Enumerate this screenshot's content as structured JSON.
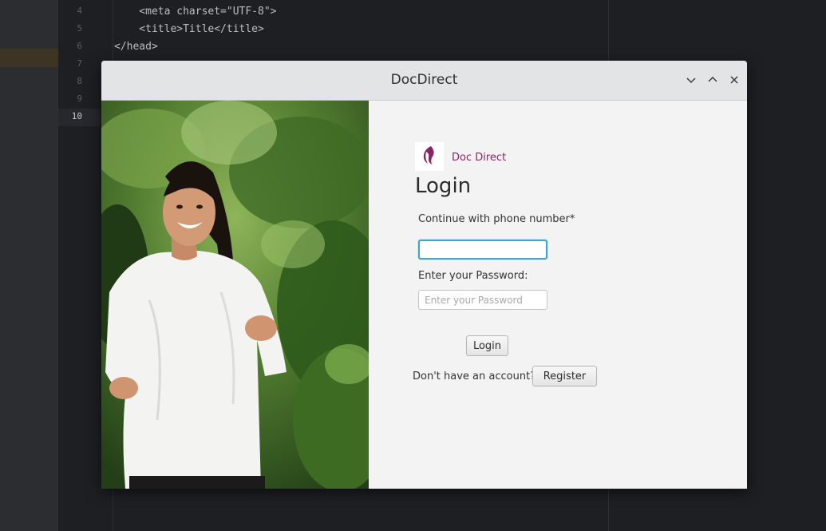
{
  "editor": {
    "line_numbers": [
      "4",
      "5",
      "6",
      "7",
      "8",
      "9",
      "10"
    ],
    "code_lines": [
      "    <meta charset=\"UTF-8\">",
      "    <title>Title</title>",
      "</head>"
    ]
  },
  "window": {
    "title": "DocDirect",
    "controls": {
      "minimize_icon": "chevron-down-icon",
      "maximize_icon": "chevron-up-icon",
      "close_icon": "close-icon"
    }
  },
  "brand": {
    "name": "Doc Direct",
    "color": "#8b2467"
  },
  "login": {
    "heading": "Login",
    "phone_label": "Continue with phone number*",
    "phone_value": "",
    "password_label": "Enter your Password:",
    "password_placeholder": "Enter your Password",
    "login_button": "Login",
    "register_prompt": "Don't have an account?",
    "register_button": "Register"
  }
}
